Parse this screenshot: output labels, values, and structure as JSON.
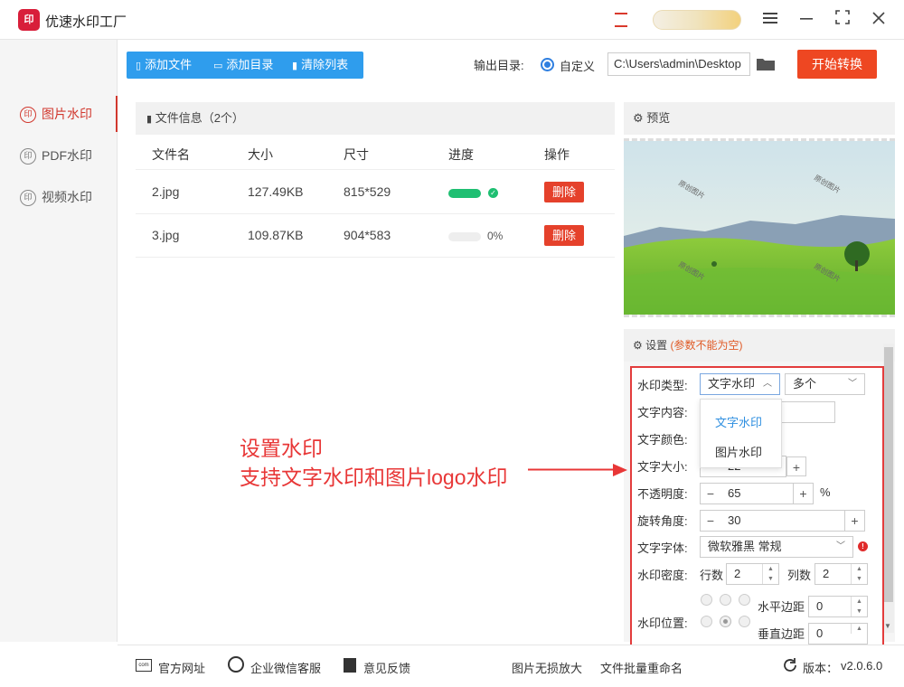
{
  "app": {
    "title": "优速水印工厂",
    "logo_text": "印"
  },
  "window": {
    "menu_icon": "menu-icon",
    "minimize": "minimize-icon",
    "maximize": "maximize-icon",
    "close": "close-icon"
  },
  "sidebar": {
    "items": [
      {
        "label": "图片水印",
        "icon": "印",
        "active": true
      },
      {
        "label": "PDF水印",
        "icon": "印",
        "active": false
      },
      {
        "label": "视频水印",
        "icon": "印",
        "active": false
      }
    ]
  },
  "toolbar": {
    "add_file": "添加文件",
    "add_dir": "添加目录",
    "clear_list": "清除列表",
    "output_label": "输出目录:",
    "custom_label": "自定义",
    "output_path": "C:\\Users\\admin\\Desktop",
    "start_button": "开始转换"
  },
  "file_panel": {
    "header": "文件信息（2个）",
    "columns": [
      "文件名",
      "大小",
      "尺寸",
      "进度",
      "操作"
    ],
    "rows": [
      {
        "name": "2.jpg",
        "size": "127.49KB",
        "dims": "815*529",
        "progress": 1.0,
        "progress_text": "",
        "action": "删除"
      },
      {
        "name": "3.jpg",
        "size": "109.87KB",
        "dims": "904*583",
        "progress": 0.0,
        "progress_text": "0%",
        "action": "删除"
      }
    ]
  },
  "preview": {
    "header": "预览",
    "watermark_text": "原创图片"
  },
  "settings": {
    "header": "设置",
    "note": "(参数不能为空)",
    "type_label": "水印类型:",
    "type_value": "文字水印",
    "count_value": "多个",
    "dropdown_options": [
      "文字水印",
      "图片水印"
    ],
    "content_label": "文字内容:",
    "color_label": "文字颜色:",
    "size_label": "文字大小:",
    "size_value": "22",
    "opacity_label": "不透明度:",
    "opacity_value": "65",
    "opacity_unit": "%",
    "rotation_label": "旋转角度:",
    "rotation_value": "30",
    "font_label": "文字字体:",
    "font_value": "微软雅黑 常规",
    "density_label": "水印密度:",
    "rows_label": "行数",
    "rows_value": "2",
    "cols_label": "列数",
    "cols_value": "2",
    "position_label": "水印位置:",
    "h_margin_label": "水平边距",
    "h_margin_value": "0",
    "v_margin_label": "垂直边距",
    "v_margin_value": "0"
  },
  "annotation": {
    "line1": "设置水印",
    "line2": "支持文字水印和图片logo水印",
    "color": "#e83737"
  },
  "footer": {
    "website": "官方网址",
    "wechat": "企业微信客服",
    "feedback": "意见反馈",
    "lossless": "图片无损放大",
    "rename": "文件批量重命名",
    "version_label": "版本：",
    "version": "v2.0.6.0",
    "website_icon_text": "com"
  },
  "colors": {
    "accent_blue": "#2f9ded",
    "start_orange": "#ee4722",
    "active_red": "#d1382e",
    "progress_green": "#1fbf72",
    "delete_red": "#e5412b"
  }
}
